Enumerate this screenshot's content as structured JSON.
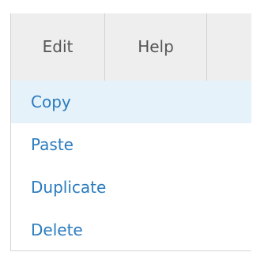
{
  "menubar": {
    "items": [
      {
        "label": "Edit"
      },
      {
        "label": "Help"
      }
    ]
  },
  "dropdown": {
    "items": [
      {
        "label": "Copy",
        "highlighted": true
      },
      {
        "label": "Paste"
      },
      {
        "label": "Duplicate"
      },
      {
        "label": "Delete"
      }
    ]
  },
  "colors": {
    "menubar_bg": "#eeeeee",
    "menu_text": "#555555",
    "item_text": "#2a7bbf",
    "highlight_bg": "#e6f2fa"
  }
}
